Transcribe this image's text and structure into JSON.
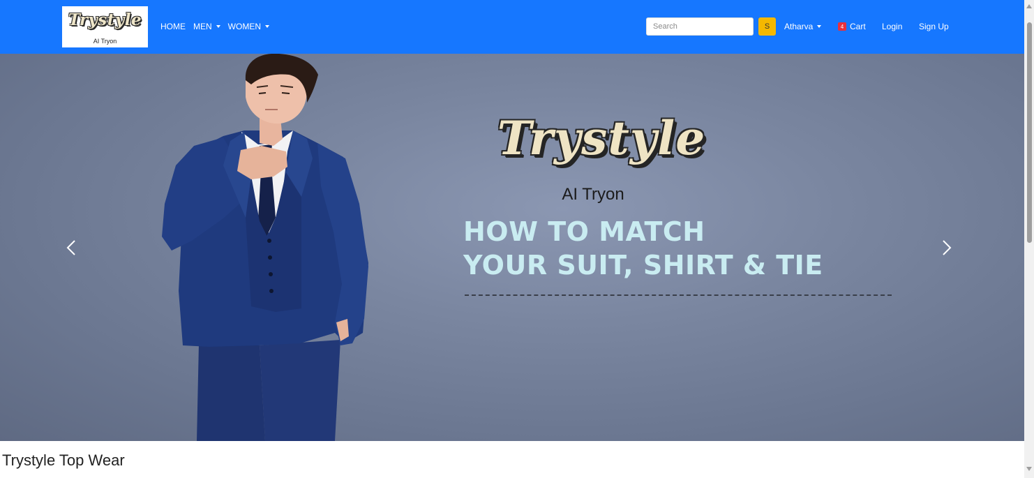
{
  "navbar": {
    "logo": {
      "text": "Trystyle",
      "subtitle": "AI Tryon"
    },
    "links": [
      {
        "label": "HOME"
      },
      {
        "label": "MEN"
      },
      {
        "label": "WOMEN"
      }
    ],
    "search": {
      "placeholder": "Search",
      "button_label": "S"
    },
    "user_menu": {
      "label": "Atharva"
    },
    "cart": {
      "count": "4",
      "label": "Cart"
    },
    "login_label": "Login",
    "signup_label": "Sign Up",
    "colors": {
      "bar": "#1677ff",
      "search_button": "#f5b800",
      "badge": "#e8303d"
    }
  },
  "hero": {
    "brand": "Trystyle",
    "brand_subtitle": "AI Tryon",
    "headline_line1": "HOW TO MATCH",
    "headline_line2": "YOUR SUIT, SHIRT & TIE",
    "prev_icon": "chevron-left-icon",
    "next_icon": "chevron-right-icon"
  },
  "section": {
    "title": "Trystyle Top Wear"
  }
}
